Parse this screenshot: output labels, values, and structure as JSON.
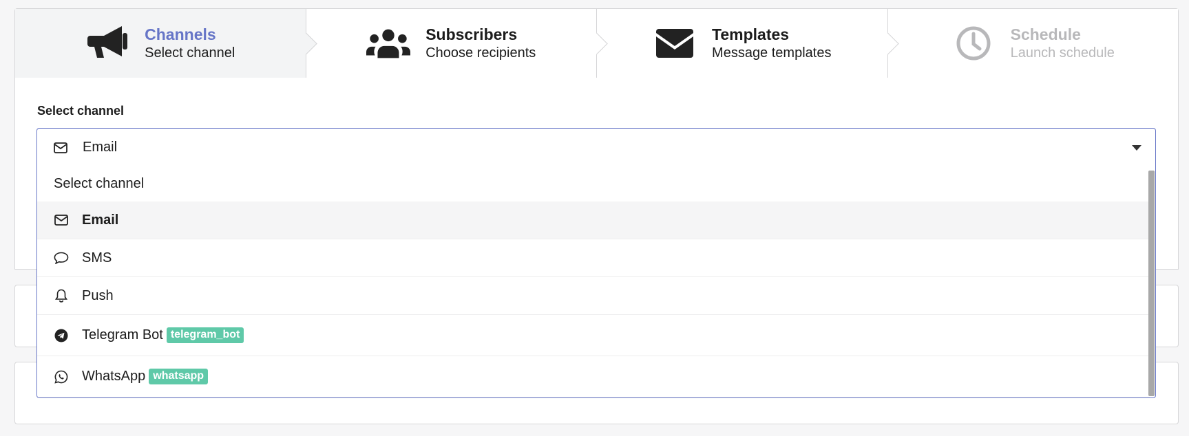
{
  "steps": [
    {
      "title": "Channels",
      "subtitle": "Select channel",
      "icon": "megaphone-icon",
      "state": "active"
    },
    {
      "title": "Subscribers",
      "subtitle": "Choose recipients",
      "icon": "users-icon",
      "state": "normal"
    },
    {
      "title": "Templates",
      "subtitle": "Message templates",
      "icon": "envelope-icon",
      "state": "normal"
    },
    {
      "title": "Schedule",
      "subtitle": "Launch schedule",
      "icon": "clock-icon",
      "state": "disabled"
    }
  ],
  "form": {
    "label": "Select channel",
    "selected": {
      "label": "Email",
      "icon": "mail-icon"
    }
  },
  "dropdown": {
    "placeholder": "Select channel",
    "options": [
      {
        "label": "Email",
        "icon": "mail-icon",
        "badge": "",
        "highlighted": true
      },
      {
        "label": "SMS",
        "icon": "chat-bubble-icon",
        "badge": ""
      },
      {
        "label": "Push",
        "icon": "bell-icon",
        "badge": ""
      },
      {
        "label": "Telegram Bot",
        "icon": "telegram-icon",
        "badge": "telegram_bot"
      },
      {
        "label": "WhatsApp",
        "icon": "whatsapp-icon",
        "badge": "whatsapp"
      }
    ]
  },
  "colors": {
    "accent": "#6675c7",
    "badge": "#5fc9a8",
    "disabled": "#b8b8ba"
  }
}
